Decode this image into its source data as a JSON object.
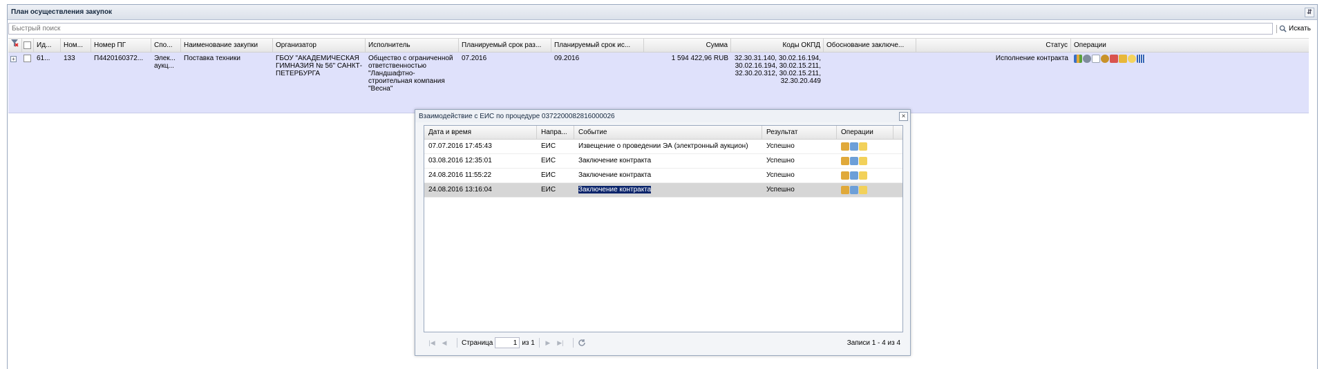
{
  "panel": {
    "title": "План осуществления закупок"
  },
  "search": {
    "placeholder": "Быстрый поиск",
    "button_label": "Искать"
  },
  "grid": {
    "columns": [
      "Ид...",
      "Ном...",
      "Номер ПГ",
      "Спо...",
      "Наименование закупки",
      "Организатор",
      "Исполнитель",
      "Планируемый срок раз...",
      "Планируемый срок ис...",
      "Сумма",
      "Коды ОКПД",
      "Обоснование заключе...",
      "Статус",
      "Операции"
    ],
    "row": {
      "id": "61...",
      "num": "133",
      "pg_number": "П4420160372...",
      "method": "Элек... аукц...",
      "name": "Поставка техники",
      "organizer": "ГБОУ \"АКАДЕМИЧЕСКАЯ ГИМНАЗИЯ № 56\" САНКТ-ПЕТЕРБУРГА",
      "executor": "Общество с ограниченной ответственностью \"Ландшафтно-строительная компания \"Весна\"",
      "plan_date_start": "07.2016",
      "plan_date_end": "09.2016",
      "sum": "1 594 422,96 RUB",
      "okpd_codes": "32.30.31.140, 30.02.16.194, 30.02.16.194, 30.02.15.211, 32.30.20.312, 30.02.15.211, 32.30.20.449",
      "justification": "",
      "status": "Исполнение контракта"
    }
  },
  "modal": {
    "title": "Взаимодействие с ЕИС по процедуре 0372200082816000026",
    "columns": [
      "Дата и время",
      "Напра...",
      "Событие",
      "Результат",
      "Операции"
    ],
    "rows": [
      {
        "datetime": "07.07.2016 17:45:43",
        "direction": "ЕИС",
        "event": "Извещение о проведении ЭА (электронный аукцион)",
        "result": "Успешно"
      },
      {
        "datetime": "03.08.2016 12:35:01",
        "direction": "ЕИС",
        "event": "Заключение контракта",
        "result": "Успешно"
      },
      {
        "datetime": "24.08.2016 11:55:22",
        "direction": "ЕИС",
        "event": "Заключение контракта",
        "result": "Успешно"
      },
      {
        "datetime": "24.08.2016 13:16:04",
        "direction": "ЕИС",
        "event": "Заключение контракта",
        "result": "Успешно"
      }
    ],
    "pager": {
      "page_label": "Страница",
      "page_value": "1",
      "of_label": "из 1",
      "records_label": "Записи 1 - 4 из 4"
    }
  }
}
